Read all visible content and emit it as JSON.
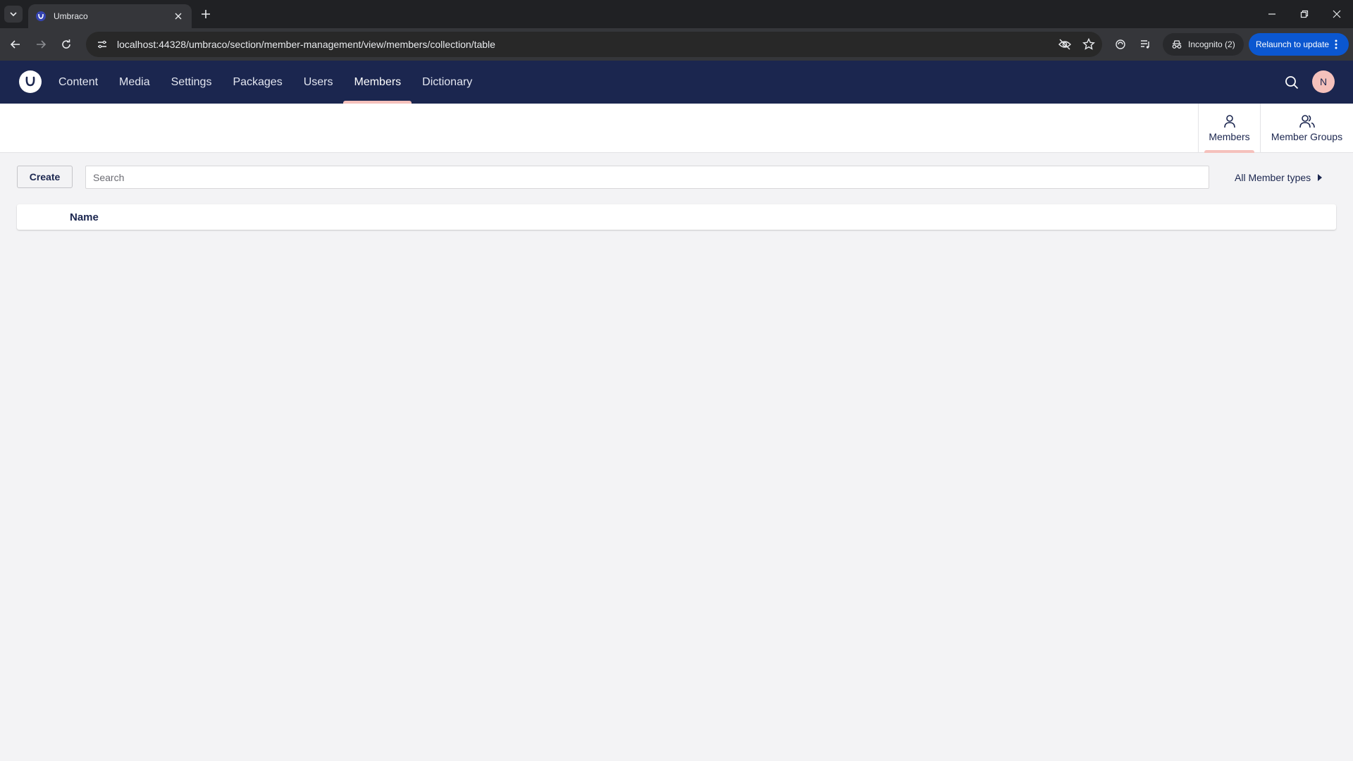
{
  "browser": {
    "tab_title": "Umbraco",
    "url": "localhost:44328/umbraco/section/member-management/view/members/collection/table",
    "incognito_label": "Incognito (2)",
    "relaunch_label": "Relaunch to update"
  },
  "header": {
    "sections": [
      {
        "label": "Content"
      },
      {
        "label": "Media"
      },
      {
        "label": "Settings"
      },
      {
        "label": "Packages"
      },
      {
        "label": "Users"
      },
      {
        "label": "Members",
        "active": true
      },
      {
        "label": "Dictionary"
      }
    ],
    "avatar_initial": "N"
  },
  "workspace_views": [
    {
      "label": "Members",
      "icon": "user-icon",
      "active": true
    },
    {
      "label": "Member Groups",
      "icon": "users-icon"
    }
  ],
  "collection": {
    "create_label": "Create",
    "search_placeholder": "Search",
    "search_value": "",
    "type_filter_label": "All Member types",
    "columns": [
      "Name"
    ],
    "rows": []
  },
  "colors": {
    "header_bg": "#1b264f",
    "accent": "#f5c1bc",
    "page_bg": "#f3f3f5",
    "relaunch_bg": "#0b57d0"
  }
}
